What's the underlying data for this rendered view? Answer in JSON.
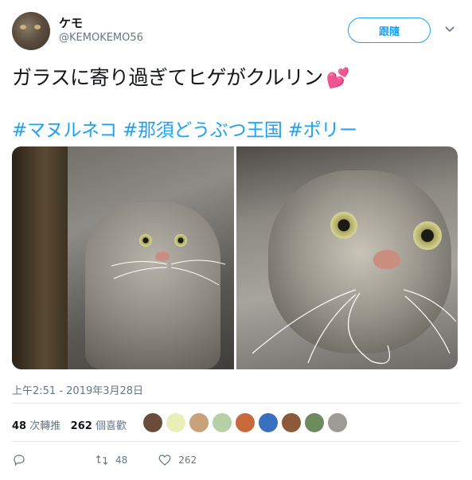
{
  "user": {
    "display_name": "ケモ",
    "handle": "@KEMOKEMO56"
  },
  "follow_button": {
    "label": "跟隨"
  },
  "tweet": {
    "text": "ガラスに寄り過ぎてヒゲがクルリン",
    "hashtags": [
      "#マヌルネコ",
      "#那須どうぶつ王国",
      "#ポリー"
    ],
    "timestamp": "上午2:51 - 2019年3月28日"
  },
  "stats": {
    "retweets_count": "48",
    "retweets_label": "次轉推",
    "likes_count": "262",
    "likes_label": "個喜歡"
  },
  "likers": [
    {
      "color": "#6b4b3a"
    },
    {
      "color": "#e8f0b8"
    },
    {
      "color": "#c9a27a"
    },
    {
      "color": "#b6d1a8"
    },
    {
      "color": "#c86a3c"
    },
    {
      "color": "#3b6fbf"
    },
    {
      "color": "#8a5a3a"
    },
    {
      "color": "#6f8a5e"
    },
    {
      "color": "#9c9c94"
    }
  ],
  "actions": {
    "reply_count": "",
    "retweet_count": "48",
    "like_count": "262"
  },
  "icons": {
    "chevron": "chevron-down-icon",
    "reply": "reply-icon",
    "retweet": "retweet-icon",
    "like": "heart-icon"
  },
  "colors": {
    "accent": "#1da1f2",
    "muted": "#657786",
    "heart": "#e0245e"
  }
}
